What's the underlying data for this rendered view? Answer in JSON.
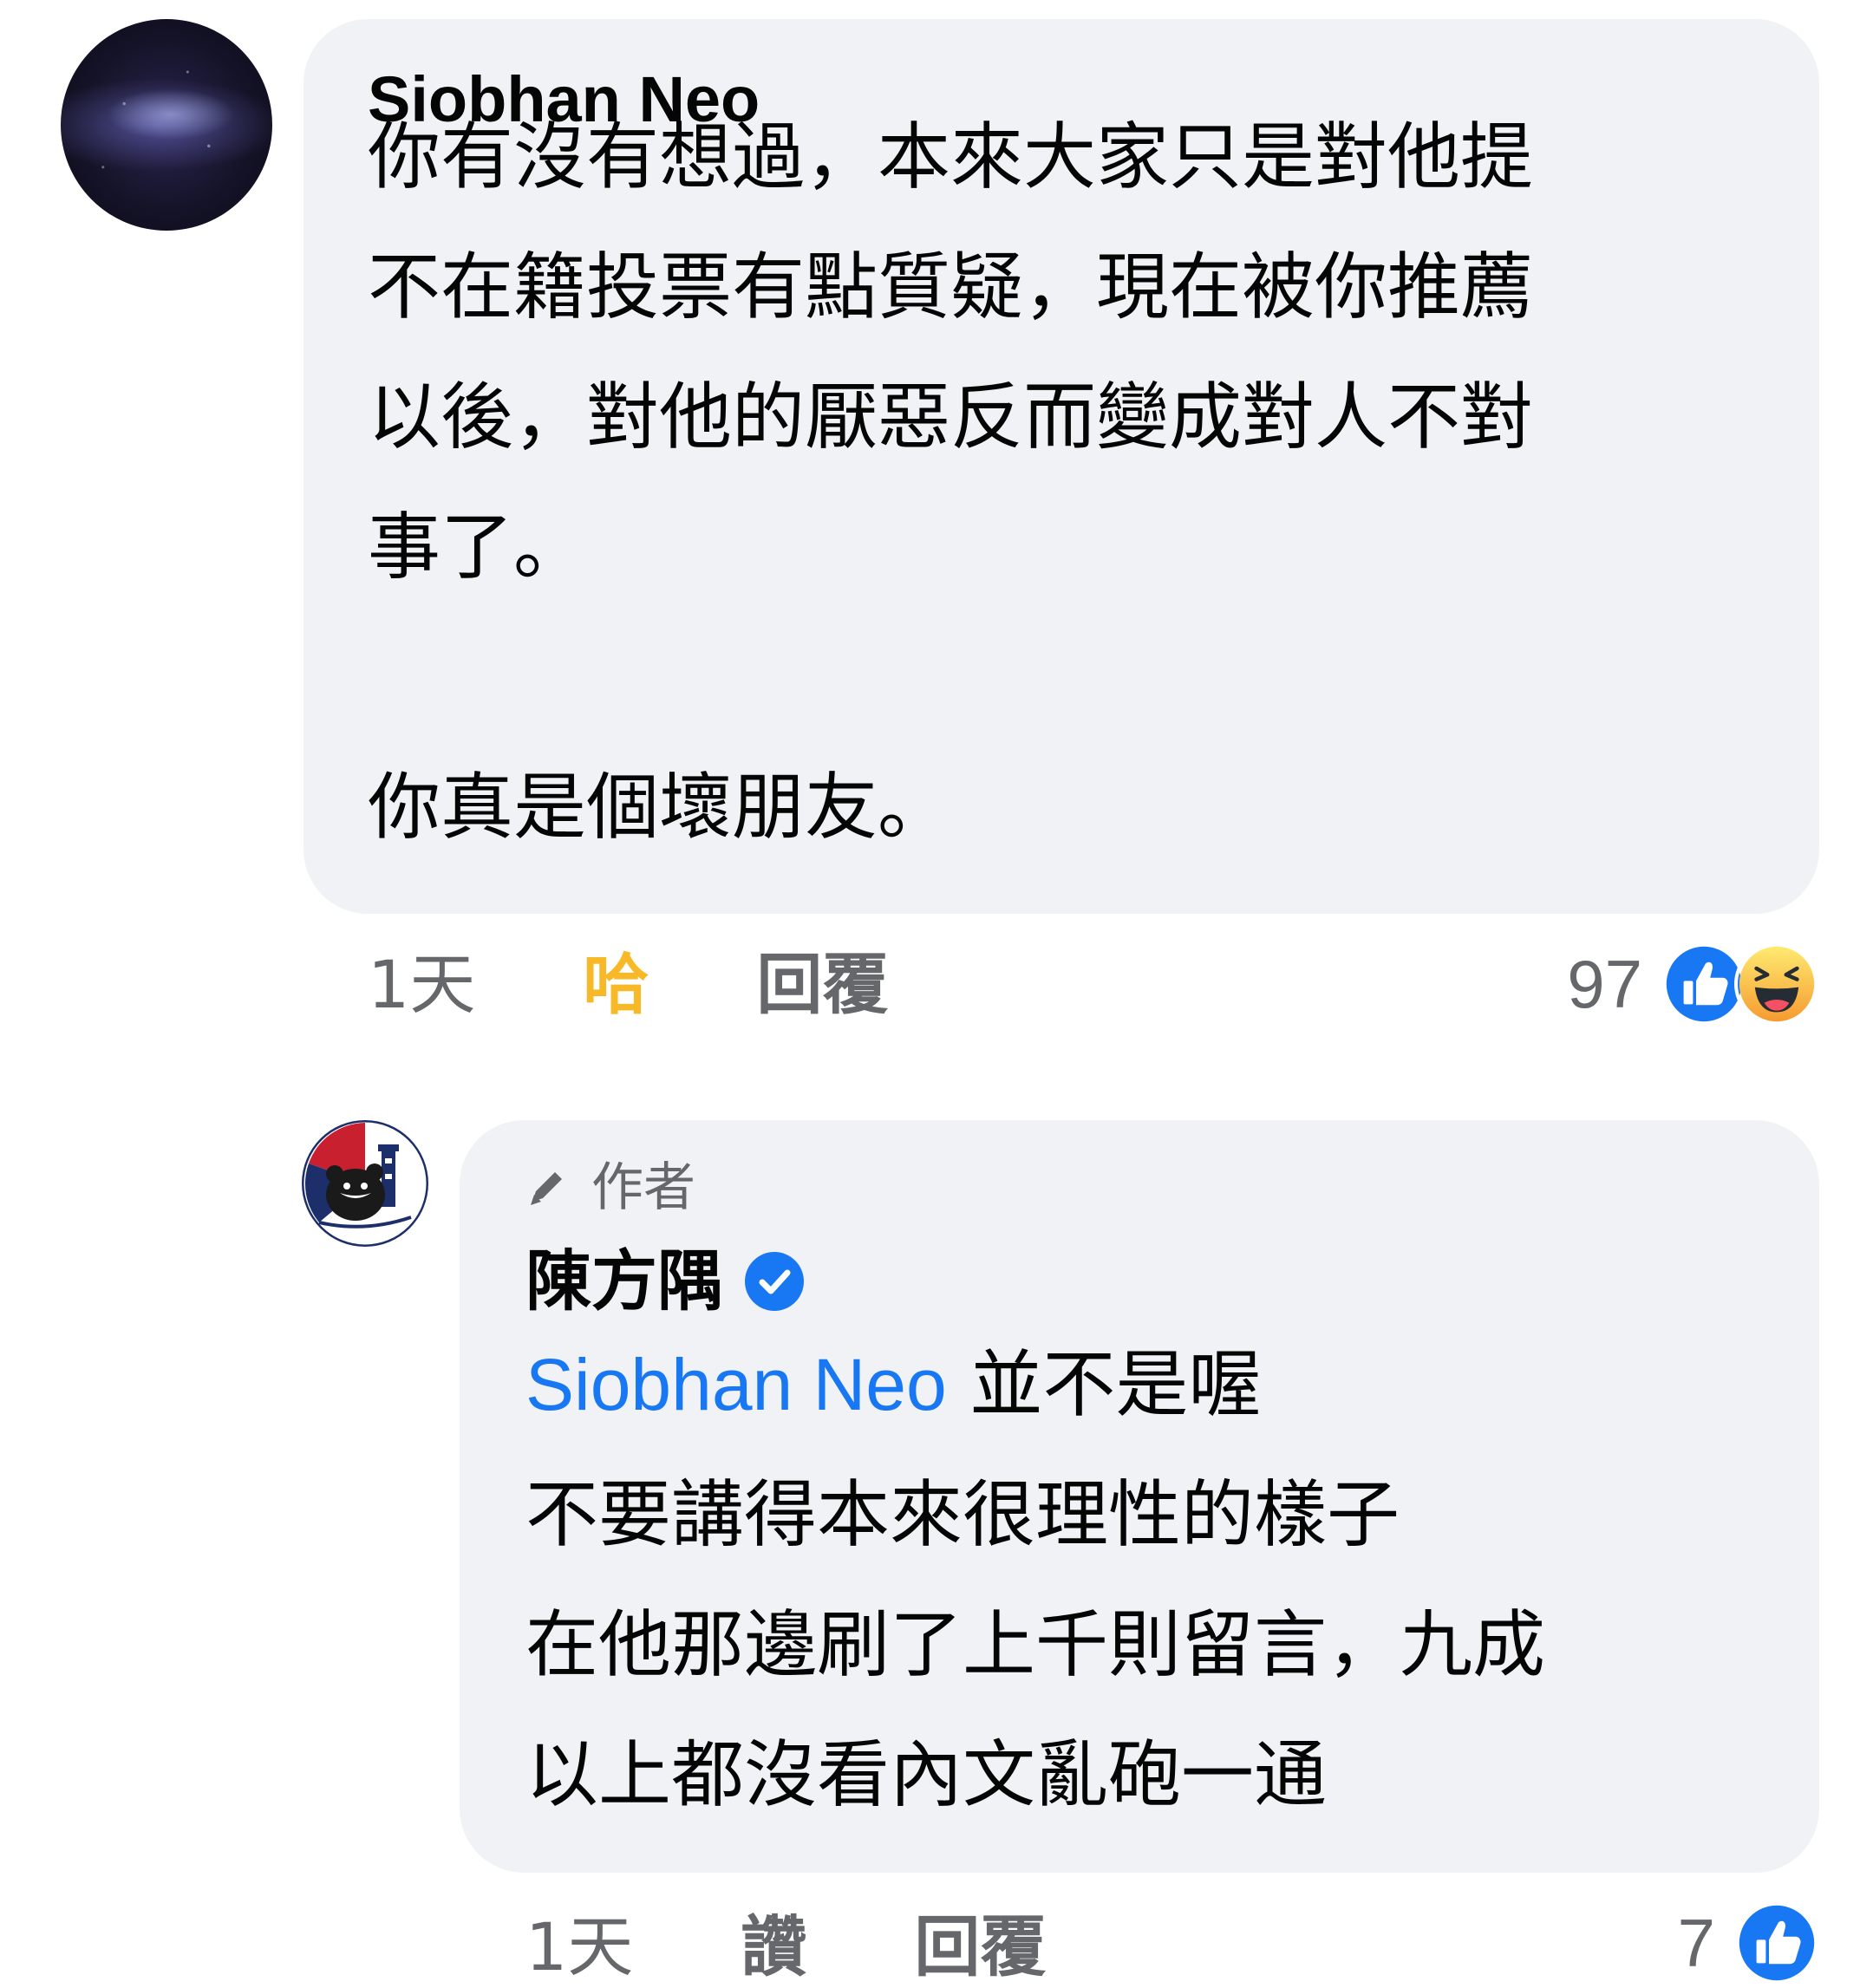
{
  "comment": {
    "author": "Siobhan Neo",
    "lines": [
      "你有沒有想過，本來大家只是對他提",
      "不在籍投票有點質疑，現在被你推薦",
      "以後，對他的厭惡反而變成對人不對",
      "事了。",
      "",
      "你真是個壞朋友。"
    ],
    "time": "1天",
    "reaction_action": "哈",
    "reply_action": "回覆",
    "reaction_count": "97",
    "reaction_icons": [
      "like-icon",
      "haha-icon"
    ]
  },
  "reply": {
    "badge_label": "作者",
    "badge_icon": "pen-icon",
    "author": "陳方隅",
    "verified_icon": "verified-badge-icon",
    "mention": "Siobhan Neo",
    "first_line_rest": " 並不是喔",
    "lines": [
      "不要講得本來很理性的樣子",
      "在他那邊刷了上千則留言，九成",
      "以上都沒看內文亂砲一通"
    ],
    "time": "1天",
    "like_action": "讚",
    "reply_action": "回覆",
    "reaction_count": "7",
    "reaction_icons": [
      "like-icon"
    ]
  },
  "colors": {
    "bubble": "#f0f2f5",
    "secondary_text": "#65676b",
    "link": "#1877f2",
    "haha_active": "#f7b928"
  }
}
